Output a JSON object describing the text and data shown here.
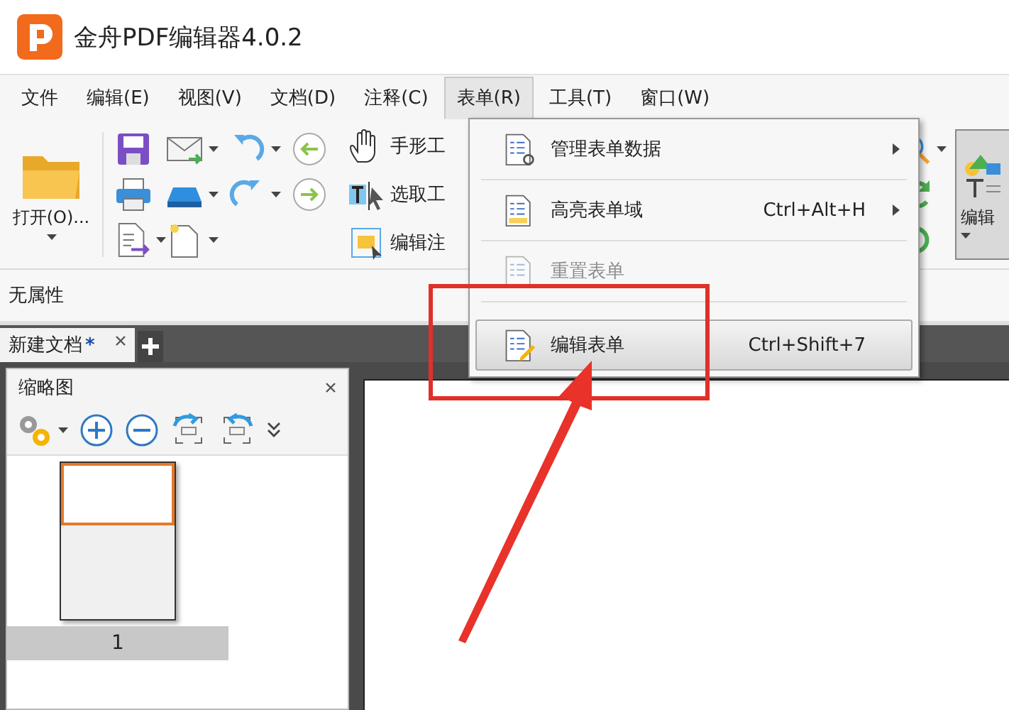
{
  "window": {
    "title": "金舟PDF编辑器4.0.2"
  },
  "menu_bar": [
    {
      "label": "文件",
      "selected": false
    },
    {
      "label": "编辑(E)",
      "selected": false
    },
    {
      "label": "视图(V)",
      "selected": false
    },
    {
      "label": "文档(D)",
      "selected": false
    },
    {
      "label": "注释(C)",
      "selected": false
    },
    {
      "label": "表单(R)",
      "selected": true
    },
    {
      "label": "工具(T)",
      "selected": false
    },
    {
      "label": "窗口(W)",
      "selected": false
    }
  ],
  "ribbon": {
    "open_button": {
      "label": "打开(O)..."
    },
    "tools": [
      {
        "kind": "hand",
        "label": "手形工"
      },
      {
        "kind": "select",
        "label": "选取工"
      },
      {
        "kind": "note",
        "label": "编辑注"
      }
    ],
    "edit_button": {
      "label": "编辑"
    }
  },
  "property_bar": {
    "text": "无属性"
  },
  "doc_tabs": [
    {
      "label": "新建文档",
      "marker": "*",
      "selected": true
    }
  ],
  "thumbnail_panel": {
    "title": "缩略图",
    "pages": [
      {
        "label": "1",
        "selected": true
      }
    ]
  },
  "dropdown_menu": {
    "items": [
      {
        "label": "管理表单数据",
        "submenu": true,
        "disabled": false,
        "selected": false
      },
      {
        "label": "高亮表单域",
        "shortcut": "Ctrl+Alt+H",
        "submenu": true,
        "disabled": false,
        "selected": false
      },
      {
        "label": "重置表单",
        "submenu": false,
        "disabled": true,
        "selected": false
      },
      {
        "label": "编辑表单",
        "shortcut": "Ctrl+Shift+7",
        "submenu": false,
        "disabled": false,
        "selected": true
      }
    ]
  }
}
